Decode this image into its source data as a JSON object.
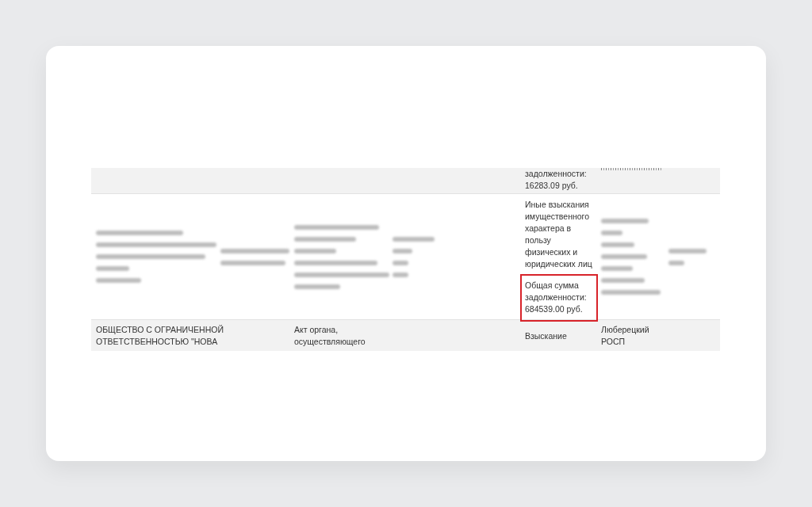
{
  "table": {
    "rows": [
      {
        "cells": [
          {
            "kind": "empty"
          },
          {
            "kind": "empty"
          },
          {
            "kind": "empty"
          },
          {
            "kind": "empty"
          },
          {
            "kind": "text",
            "text": "задолженности: 16283.09 руб."
          },
          {
            "kind": "cut"
          },
          {
            "kind": "empty"
          }
        ]
      },
      {
        "cells": [
          {
            "kind": "blurred"
          },
          {
            "kind": "blurred"
          },
          {
            "kind": "blurred"
          },
          {
            "kind": "blurred"
          },
          {
            "kind": "amount",
            "text": "Иные взыскания имущественного характера в пользу физических и юридических лиц",
            "total": "Общая сумма задолженности: 684539.00 руб.",
            "highlighted": true
          },
          {
            "kind": "blurred"
          },
          {
            "kind": "blurred"
          }
        ]
      },
      {
        "cells": [
          {
            "kind": "text",
            "text": "ОБЩЕСТВО С ОГРАНИЧЕННОЙ ОТВЕТСТВЕННОСТЬЮ \"НОВА"
          },
          {
            "kind": "empty"
          },
          {
            "kind": "text",
            "text": "Акт органа, осуществляющего"
          },
          {
            "kind": "empty"
          },
          {
            "kind": "text",
            "text": "Взыскание"
          },
          {
            "kind": "text",
            "text": "Люберецкий РОСП"
          },
          {
            "kind": "empty"
          }
        ]
      }
    ]
  }
}
